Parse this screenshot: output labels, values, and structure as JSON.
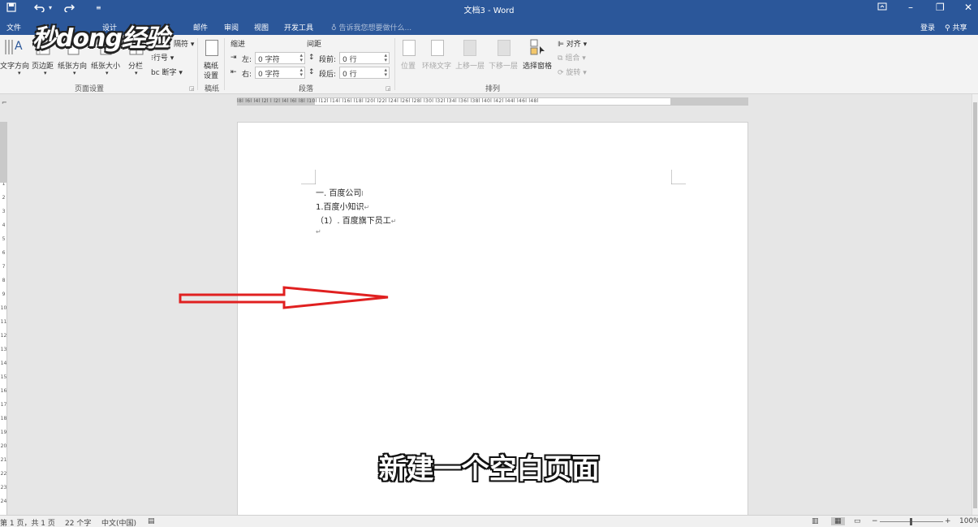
{
  "window": {
    "title": "文档3 - Word",
    "qat": {
      "save_icon": "save-icon",
      "undo_icon": "undo-icon",
      "redo_icon": "redo-icon",
      "customize_icon": "customize-icon"
    },
    "controls": {
      "ribbon_display": "ribbon-display-icon",
      "minimize": "–",
      "restore": "❐",
      "close": "✕"
    }
  },
  "tabs": {
    "file": "文件",
    "design": "设计",
    "mailings": "邮件",
    "review": "审阅",
    "view": "视图",
    "developer": "开发工具",
    "tell_me": "告诉我您想要做什么...",
    "login": "登录",
    "share": "共享"
  },
  "logo_text": "秒dong经验",
  "ribbon": {
    "page_setup": {
      "text_direction": "文字方向",
      "margins": "页边距",
      "orientation": "纸张方向",
      "size": "纸张大小",
      "columns": "分栏",
      "breaks_partial": "隔符",
      "line_numbers": "行号",
      "hyphenation": "断字",
      "group_label": "页面设置"
    },
    "manuscript": {
      "settings_line1": "稿纸",
      "settings_line2": "设置",
      "group_label": "稿纸"
    },
    "paragraph": {
      "indent_header": "缩进",
      "spacing_header": "间距",
      "left_label": "左:",
      "left_value": "0 字符",
      "right_label": "右:",
      "right_value": "0 字符",
      "before_label": "段前:",
      "before_value": "0 行",
      "after_label": "段后:",
      "after_value": "0 行",
      "group_label": "段落"
    },
    "arrange": {
      "position": "位置",
      "wrap_text": "环绕文字",
      "bring_forward": "上移一层",
      "send_backward": "下移一层",
      "selection_pane": "选择窗格",
      "align": "对齐",
      "group": "组合",
      "rotate": "旋转",
      "group_label": "排列"
    }
  },
  "ruler": {
    "horizontal_ticks": "l8l l6l l4l l2l l l2l l4l l6l l8l l10l l12l l14l l16l l18l l20l l22l l24l l26l l28l l30l l32l l34l l36l l38l l40l l42l l44l l46l l48l",
    "vertical_ticks": [
      "4",
      "3",
      "2",
      "1",
      "1",
      "2",
      "3",
      "4",
      "5",
      "6",
      "7",
      "8",
      "9",
      "10",
      "11",
      "12",
      "13",
      "14",
      "15",
      "16",
      "17",
      "18",
      "19",
      "20",
      "21",
      "22",
      "23",
      "24"
    ]
  },
  "document": {
    "lines": [
      {
        "text": "一. 百度公司",
        "mark": "I"
      },
      {
        "text": "1.百度小知识",
        "mark": "↵"
      },
      {
        "text": "（1）. 百度旗下员工",
        "mark": "↵"
      },
      {
        "text": "",
        "mark": "↵"
      }
    ]
  },
  "caption": "新建一个空白页面",
  "status": {
    "page": "第 1 页，共 1 页",
    "words": "22 个字",
    "language": "中文(中国)",
    "zoom_minus": "−",
    "zoom_plus": "+",
    "zoom": "100%"
  },
  "colors": {
    "accent": "#2b579a",
    "arrow": "#e02020",
    "ribbon_bg": "#f3f3f3"
  }
}
